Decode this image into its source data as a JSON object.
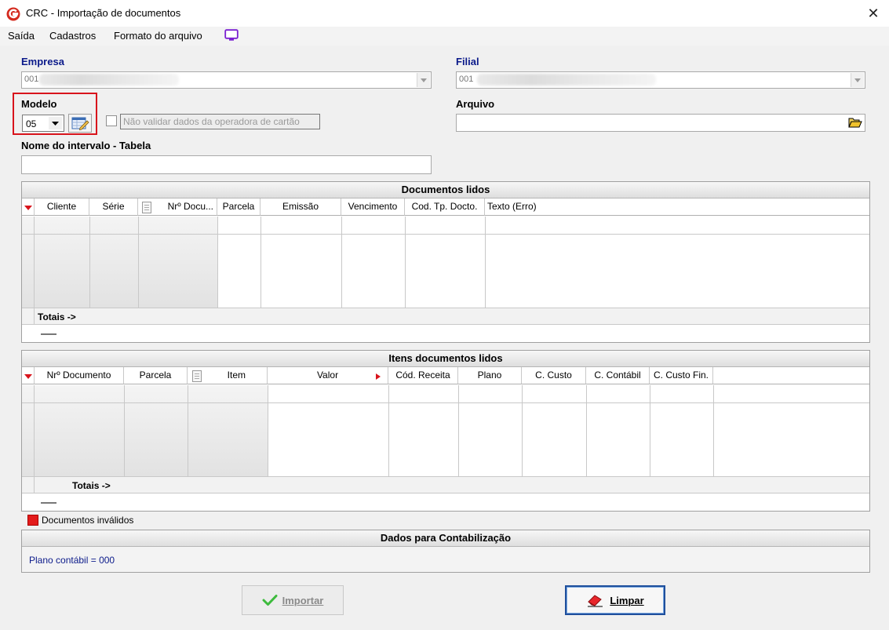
{
  "window": {
    "title": "CRC - Importação de documentos",
    "close_glyph": "✕"
  },
  "menu": {
    "items": [
      "Saída",
      "Cadastros",
      "Formato do arquivo"
    ]
  },
  "empresa": {
    "label": "Empresa",
    "value": "001"
  },
  "filial": {
    "label": "Filial",
    "value": "001"
  },
  "modelo": {
    "label": "Modelo",
    "value": "05"
  },
  "checkbox": {
    "label": "Não validar dados da operadora de cartão",
    "checked": false
  },
  "arquivo": {
    "label": "Arquivo",
    "value": ""
  },
  "intervalo": {
    "label": "Nome do intervalo - Tabela",
    "value": ""
  },
  "grid1": {
    "title": "Documentos lidos",
    "columns": [
      "Cliente",
      "Série",
      "Nrº Docu...",
      "Parcela",
      "Emissão",
      "Vencimento",
      "Cod. Tp. Docto.",
      "Texto (Erro)"
    ],
    "totals_label": "Totais ->"
  },
  "grid2": {
    "title": "Itens documentos lidos",
    "columns": [
      "Nrº Documento",
      "Parcela",
      "Item",
      "Valor",
      "Cód. Receita",
      "Plano",
      "C. Custo",
      "C. Contábil",
      "C. Custo Fin."
    ],
    "totals_label": "Totais ->"
  },
  "legend": {
    "label": "Documentos inválidos",
    "color": "#e31b1b"
  },
  "contabil": {
    "title": "Dados para Contabilização",
    "plano_text": "Plano contábil = 000"
  },
  "buttons": {
    "importar": "Importar",
    "limpar": "Limpar"
  },
  "colors": {
    "label_blue": "#0b1a8a",
    "highlight_red": "#d8141c",
    "logo_red": "#d42a1e"
  }
}
